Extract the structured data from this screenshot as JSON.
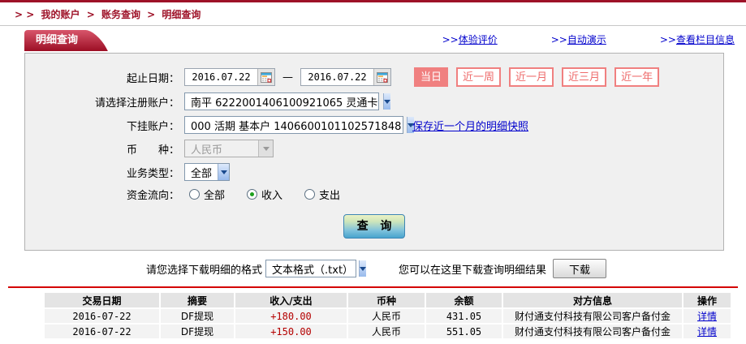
{
  "colors": {
    "brand_red": "#9e1228",
    "tab_top": "#d8566b",
    "tab_bottom": "#9c0e24",
    "link_blue": "#0000cc",
    "pink": "#f08080",
    "pink_text": "#ee6a6a",
    "income_red": "#b40000",
    "divider_red": "#d40000",
    "panel_bg": "#f0f0f0"
  },
  "breadcrumb": {
    "prefix": "> >",
    "separator": ">",
    "items": [
      "我的账户",
      "账务查询",
      "明细查询"
    ]
  },
  "tab": {
    "label": "明细查询"
  },
  "header_links": [
    {
      "prefix": ">>",
      "label": "体验评价"
    },
    {
      "prefix": ">>",
      "label": "自动演示"
    },
    {
      "prefix": ">>",
      "label": "查看栏目信息"
    }
  ],
  "form": {
    "date_range": {
      "label": "起止日期：",
      "start_value": "2016.07.22",
      "end_value": "2016.07.22",
      "separator": "—"
    },
    "quick_ranges": [
      {
        "label": "当日",
        "active": true
      },
      {
        "label": "近一周",
        "active": false
      },
      {
        "label": "近一月",
        "active": false
      },
      {
        "label": "近三月",
        "active": false
      },
      {
        "label": "近一年",
        "active": false
      }
    ],
    "registered_account": {
      "label": "请选择注册账户：",
      "value": "南平 6222001406100921065 灵通卡"
    },
    "sub_account": {
      "label": "下挂账户：",
      "value": "000 活期 基本户 1406600101102571848",
      "snapshot_link": "保存近一个月的明细快照"
    },
    "currency": {
      "label": "币　　种：",
      "value": "人民币"
    },
    "business_type": {
      "label": "业务类型：",
      "value": "全部"
    },
    "fund_flow": {
      "label": "资金流向：",
      "options": [
        {
          "label": "全部",
          "checked": false
        },
        {
          "label": "收入",
          "checked": true
        },
        {
          "label": "支出",
          "checked": false
        }
      ]
    },
    "query_button": "查 询"
  },
  "download": {
    "format_label": "请您选择下载明细的格式",
    "format_value": "文本格式（.txt）",
    "hint": "您可以在这里下载查询明细结果",
    "button_label": "下载"
  },
  "table": {
    "headers": [
      "交易日期",
      "摘要",
      "收入/支出",
      "币种",
      "余额",
      "对方信息",
      "操作"
    ],
    "rows": [
      {
        "date": "2016-07-22",
        "summary": "DF提现",
        "amount": "+180.00",
        "currency": "人民币",
        "balance": "431.05",
        "counterparty": "财付通支付科技有限公司客户备付金",
        "action": "详情"
      },
      {
        "date": "2016-07-22",
        "summary": "DF提现",
        "amount": "+150.00",
        "currency": "人民币",
        "balance": "551.05",
        "counterparty": "财付通支付科技有限公司客户备付金",
        "action": "详情"
      }
    ]
  }
}
